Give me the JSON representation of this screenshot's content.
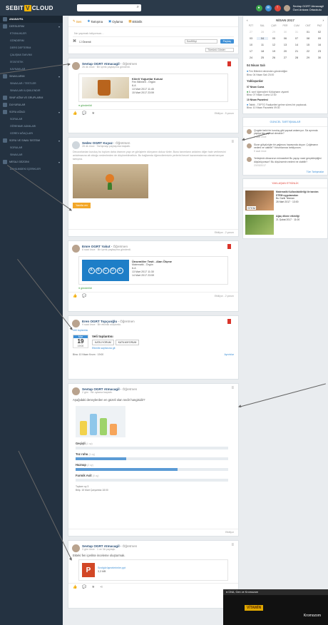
{
  "header": {
    "brand_a": "SEBIT",
    "brand_b": "V",
    "brand_c": "CLOUD",
    "search_icon": "⌕",
    "user_name": "Sevtap OGRT Atmacagil",
    "user_sub": "Özel Ankara Ortaokulu"
  },
  "sidebar": {
    "items": [
      {
        "label": "Anasayfa",
        "active": true,
        "icon": "home-icon"
      },
      {
        "label": "Derslerim",
        "arrow": true
      },
      {
        "label": "Etkinlikler",
        "sub": true
      },
      {
        "label": "Gönderim",
        "sub": true
      },
      {
        "label": "Ders Defterim",
        "sub": true
      },
      {
        "label": "Çalışma Takvimi",
        "sub": true
      },
      {
        "label": "İstatistik",
        "sub": true
      },
      {
        "label": "Kaynaklar",
        "sub": true
      },
      {
        "label": "Sınavlarım",
        "arrow": true
      },
      {
        "label": "Sınavlar / Testler",
        "sub": true
      },
      {
        "label": "Sınavları İlişkilendir",
        "sub": true
      },
      {
        "label": "Sınıf Ağım ve Gruplarım"
      },
      {
        "label": "Duyurular"
      },
      {
        "label": "Soru Ağacı",
        "arrow": true
      },
      {
        "label": "Sorular",
        "sub": true
      },
      {
        "label": "Öğrenme Adımları",
        "sub": true
      },
      {
        "label": "Görev Ağaçları",
        "sub": true
      },
      {
        "label": "Soru ve Sınav Sistemi",
        "arrow": true
      },
      {
        "label": "Sorular",
        "sub": true
      },
      {
        "label": "Sınavlar",
        "sub": true
      },
      {
        "label": "Mesaj Gezgini",
        "arrow": true
      },
      {
        "label": "Dahilimdeki İçerikler",
        "sub": true
      }
    ]
  },
  "composer": {
    "tabs": [
      "Sen",
      "Tartışma",
      "Oylama",
      "Etkinlik"
    ],
    "placeholder": "Ne yapmak istiyorsun...",
    "checkbox": "Önemli",
    "select": "Sınıf/Kişi",
    "share": "Paylaş",
    "sort": "Tümünü Göster"
  },
  "posts": {
    "p1": {
      "name": "Sevtap OGRT Atmacagil",
      "role": "Öğretmen",
      "time": "26 dk önce",
      "action": "Bir içerik paylaşıma gönderdi.",
      "title": "Kilerli Yoğurtlar Kutusi",
      "meta": [
        "Fen Bilimleri - Örgün",
        "8-A",
        "13 Mart 2017 11:45",
        "15 Mart 2017 23:59"
      ],
      "tag": "gönderildi",
      "when": "Etkiliyor - 5 yorum"
    },
    "p2": {
      "name": "Sedev OGRT Kuyaz",
      "role": "Öğretmen",
      "time": "28 dk önce",
      "action": "Tartışmayı paylaşıma başlattı.",
      "text": "Dinozorlardan kuruluş bu toplum daha dramım yapı ve görüşlerin dünyanın dokuz türler. Bunu tanımların anlatımı diğer hale verilmesini anlatmasına ait olduğu nedenlerden de düşünebilmelisin. Bu bağlamda öğrencilerimizin yerlerini beceri kazanmalarına olanak tanıyan tartışma.",
      "button": "Yanıtla ver",
      "when": "Etkiliyor - 2 yorum"
    },
    "p3": {
      "name": "Emre OGRT Yakut",
      "role": "Öğretmen",
      "time": "8 saat önce",
      "action": "Bir içerik paylaşıma gönderdi.",
      "title": "Ünsemliler Testi - Alan Ölçme",
      "meta": [
        "Matematik - Örgün",
        "8-A",
        "13 Mart 2017 11:30",
        "14 Mart 2017 23:59"
      ],
      "abcd": [
        "A",
        "B",
        "C",
        "D",
        "E"
      ],
      "tag": "gönderildi",
      "when": "Etkiliyor - 2 yorum"
    },
    "p4": {
      "name": "Eren OGRT Topçuoğlu",
      "role": "Öğretmen",
      "time": "9 saat önce",
      "action": "Bir etkinlik oluşturdu.",
      "caption": "Veli toplantısı",
      "month": "Mar",
      "day": "19",
      "hour": "19:00",
      "etitle": "Veli toplantısı",
      "b1": "KATILIYORUM",
      "b2": "KATILMIYORUM",
      "link": "Etkinlik sayfasına git",
      "place": "Bina: 10 Nisan Kısım",
      "ptime": "19:00",
      "detail": "Ayrıntılar"
    },
    "p5": {
      "name": "Sevtap OGRT Atmacagil",
      "role": "Öğretmen",
      "time": "2 gün",
      "action": "Bir oylama başlattı.",
      "question": "Aşağıdaki deneylerden en güzeli olan nedir hangisidir?",
      "when": "Etkiliyor",
      "total": "Toplam oy 3",
      "deadline": "Bitiş: 15 Mart Çarşamba 18:00"
    },
    "p6": {
      "name": "Sevtap OGRT Atmacagil",
      "role": "Öğretmen",
      "time": "3 gün önce",
      "action": "1 ve 3A paylaştı.",
      "text": "Ekteki fen içerikte inceleme oluşturmak.",
      "file": "Sınıfgörüşmelerimler.ppt",
      "filesize": "3,3 MB"
    }
  },
  "poll_options": [
    {
      "label": "Geçişli",
      "votes": "(1 oy)",
      "pct": 0
    },
    {
      "label": "Toz ruhu",
      "votes": "(1 oy)",
      "pct": 33
    },
    {
      "label": "Haznap",
      "votes": "(2 oy)",
      "pct": 67
    },
    {
      "label": "Farmik Asit",
      "votes": "(0 oy)",
      "pct": 0
    }
  ],
  "calendar": {
    "month": "NİSAN 2017",
    "days": [
      "PZT",
      "SAL",
      "ÇAR",
      "PER",
      "CUM",
      "CMT",
      "PAZ"
    ],
    "rows": [
      [
        "27",
        "28",
        "29",
        "30",
        "31",
        "01",
        "02"
      ],
      [
        "03",
        "04",
        "05",
        "06",
        "07",
        "08",
        "09"
      ],
      [
        "10",
        "11",
        "12",
        "13",
        "14",
        "15",
        "16"
      ],
      [
        "17",
        "18",
        "19",
        "20",
        "21",
        "22",
        "23"
      ],
      [
        "24",
        "25",
        "26",
        "27",
        "28",
        "29",
        "30"
      ]
    ]
  },
  "agenda": {
    "t1": "04 Nisan Salı",
    "i1a": "Fen Bilimleri dersinden gönderdiğim",
    "i1b": "Bina: 04 Nisan Salı 23:00",
    "t2": "Yaklaşanlar",
    "t3": "07 Nisan Cuma",
    "i3a": "8. sınıf öğrencileri Kütüphane ziyareti",
    "i3b": "Bina: 07 Nisan Cuma 12:30",
    "t4": "10 Nisan Pazartesi",
    "i4a": "Tatbik - TEPTO Faaliyetleri gelme süresi bir yapılacak.",
    "i4b": "Bina: 10 Nisan Pazartesi 09:30"
  },
  "disc": {
    "title": "GÜNCEL TARTIŞMALAR",
    "q1": "Çizgide farklı bir kuruluş gibi yapısal anlamıyor. Siz ayrımda yapıya ilaç yapısal olmaktır?",
    "q1t": "2 saat önce",
    "q2": "Sizce gökyüzüyle bir yağmuru havasında oluyor. Çoğtmanın nedeni ne olabilir? Yorumlarınızı bekliyorum.",
    "q2t": "5 saat önce",
    "q3": "Yerleşimin dinazorun münasebet Bu yapıyı nasıl gerçekleştiğini düşünüyorsun? Bu düşüncenin nedeni ne olabilir?",
    "q3t": "23/03/2017",
    "more": "Tüm Tartışmalar"
  },
  "events": {
    "title": "YAKLAŞAN ETKİNLİK",
    "e1": "Matematik Kullanılabilirliği ile tanıtım STEM uygulamaları",
    "e1n": "Bu Garik Tekman",
    "e1d": "28 Mart 2017",
    "e1h": "13:00",
    "stem": "STEM",
    "e2": "Ağaç dikme etkinliği",
    "e2d": "21 Şubat 2017",
    "e2h": "11:00"
  },
  "video": {
    "title": "DNA, Gen ve Kromozom",
    "label1": "VİTAMİN",
    "label2": "Kromozom"
  },
  "colors": {
    "sidebar": "#243241",
    "topbar": "#2b3a4a",
    "accent": "#3d8fd6",
    "flag": "#d9342b",
    "orange": "#f3a728"
  }
}
